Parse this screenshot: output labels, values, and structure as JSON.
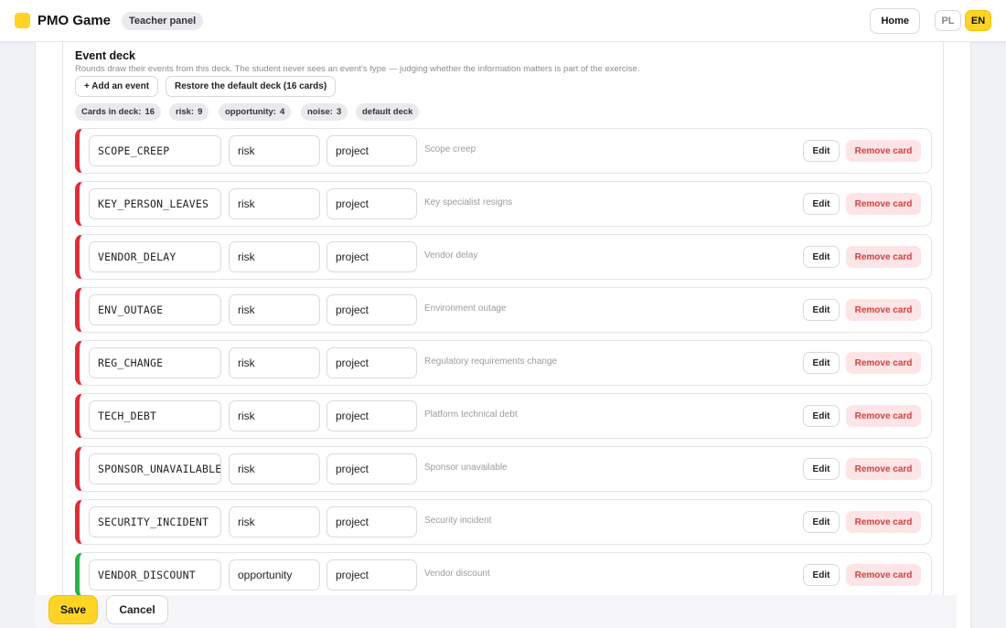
{
  "header": {
    "app_title": "PMO Game",
    "teacher_badge": "Teacher panel",
    "home_label": "Home",
    "lang_pl": "PL",
    "lang_en": "EN",
    "logo_color": "#ffd426"
  },
  "deck": {
    "title": "Event deck",
    "subtitle": "Rounds draw their events from this deck. The student never sees an event’s type — judging whether the information matters is part of the exercise.",
    "add_label": "+ Add an event",
    "restore_label": "Restore the default deck (16 cards)",
    "chips": {
      "cards_label": "Cards in deck:",
      "cards_value": "16",
      "risk_label": "risk:",
      "risk_value": "9",
      "opportunity_label": "opportunity:",
      "opportunity_value": "4",
      "noise_label": "noise:",
      "noise_value": "3",
      "default_label": "default deck"
    },
    "edit_label": "Edit",
    "remove_label": "Remove card",
    "colors": {
      "risk": "#dc2f3a",
      "opportunity": "#2bb14a"
    },
    "rows": [
      {
        "id": "SCOPE_CREEP",
        "type": "risk",
        "scope": "project",
        "description": "Scope creep"
      },
      {
        "id": "KEY_PERSON_LEAVES",
        "type": "risk",
        "scope": "project",
        "description": "Key specialist resigns"
      },
      {
        "id": "VENDOR_DELAY",
        "type": "risk",
        "scope": "project",
        "description": "Vendor delay"
      },
      {
        "id": "ENV_OUTAGE",
        "type": "risk",
        "scope": "project",
        "description": "Environment outage"
      },
      {
        "id": "REG_CHANGE",
        "type": "risk",
        "scope": "project",
        "description": "Regulatory requirements change"
      },
      {
        "id": "TECH_DEBT",
        "type": "risk",
        "scope": "project",
        "description": "Platform technical debt"
      },
      {
        "id": "SPONSOR_UNAVAILABLE",
        "type": "risk",
        "scope": "project",
        "description": "Sponsor unavailable"
      },
      {
        "id": "SECURITY_INCIDENT",
        "type": "risk",
        "scope": "project",
        "description": "Security incident"
      },
      {
        "id": "VENDOR_DISCOUNT",
        "type": "opportunity",
        "scope": "project",
        "description": "Vendor discount"
      }
    ]
  },
  "footer": {
    "save_label": "Save",
    "cancel_label": "Cancel"
  }
}
